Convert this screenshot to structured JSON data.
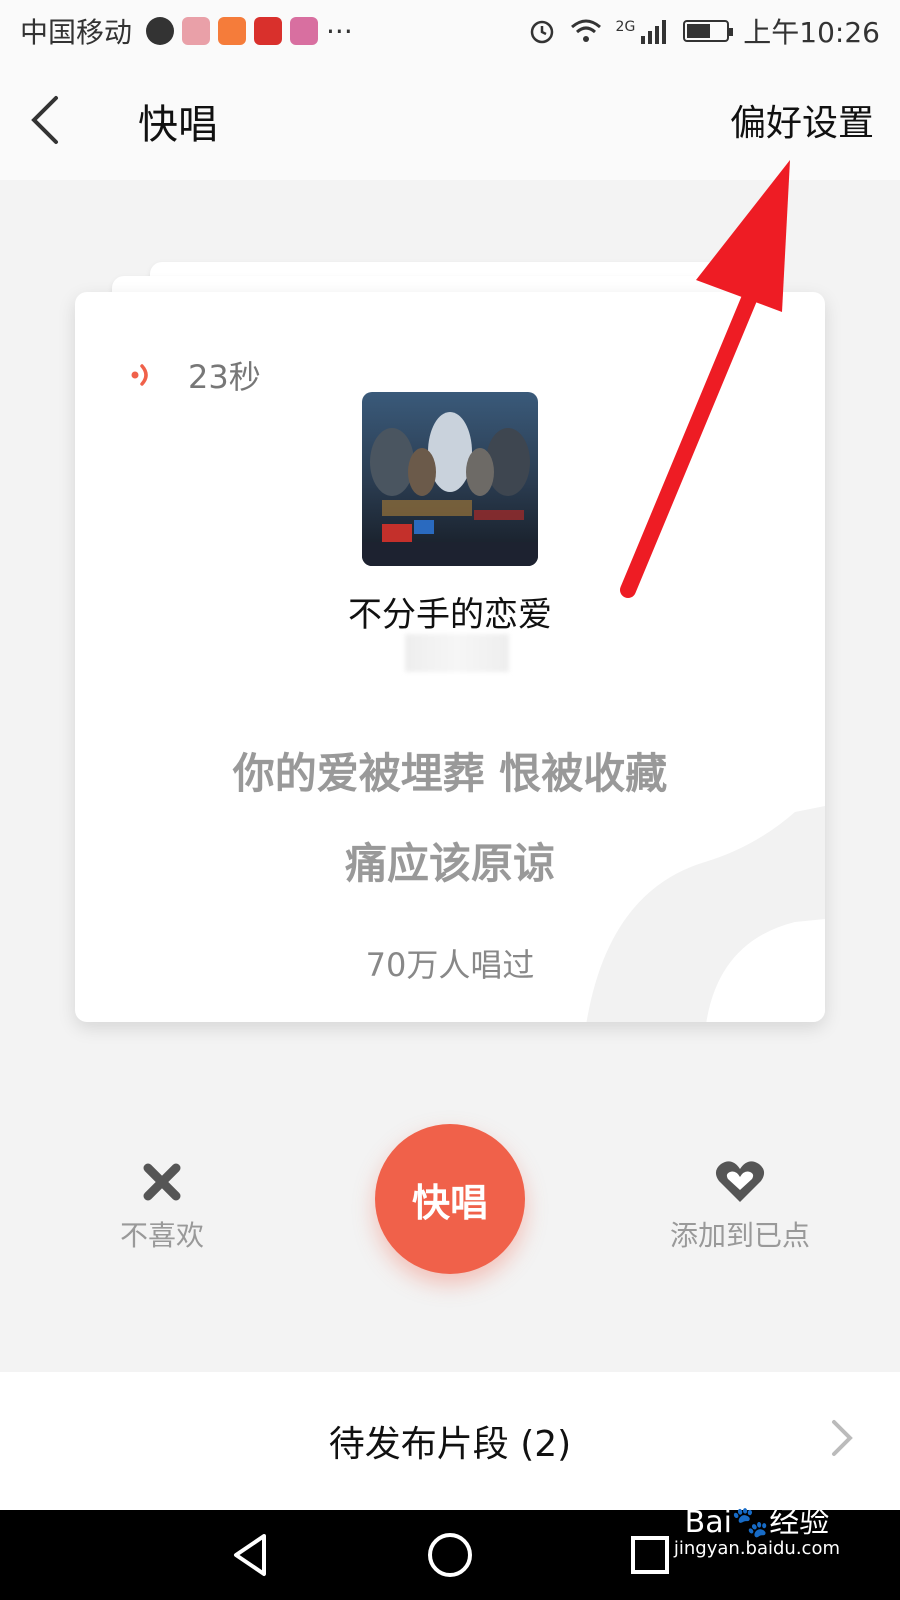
{
  "status_bar": {
    "carrier": "中国移动",
    "more": "···",
    "network": "2G",
    "time": "上午10:26",
    "battery_level": 0.6
  },
  "header": {
    "back_icon": "chevron-left-icon",
    "title": "快唱",
    "preferences_label": "偏好设置"
  },
  "card": {
    "duration": "23秒",
    "song_title": "不分手的恋爱",
    "lyric_line_1": "你的爱被埋葬 恨被收藏",
    "lyric_line_2": "痛应该原谅",
    "sung_count": "70万人唱过"
  },
  "actions": {
    "dislike_label": "不喜欢",
    "sing_label": "快唱",
    "add_label": "添加到已点"
  },
  "pending": {
    "label": "待发布片段 (2)"
  },
  "watermark": {
    "brand": "Bai",
    "brand_suffix": "经验",
    "url": "jingyan.baidu.com"
  },
  "colors": {
    "accent": "#f0614a",
    "annotation_arrow": "#ee1c24"
  }
}
